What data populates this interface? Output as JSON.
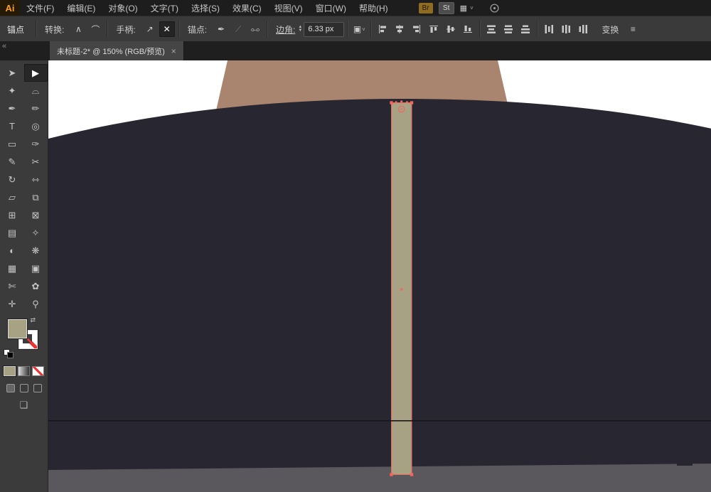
{
  "menubar": {
    "logo_text": "Ai",
    "items": [
      "文件(F)",
      "编辑(E)",
      "对象(O)",
      "文字(T)",
      "选择(S)",
      "效果(C)",
      "视图(V)",
      "窗口(W)",
      "帮助(H)"
    ],
    "br_badge": "Br",
    "st_badge": "St"
  },
  "controlbar": {
    "context_label": "锚点",
    "convert_label": "转换:",
    "handles_label": "手柄:",
    "anchors_label": "锚点:",
    "corner_label": "边角:",
    "corner_value": "6.33 px",
    "transform_label": "变换"
  },
  "tabbar": {
    "title": "未标题-2* @ 150% (RGB/预览)"
  },
  "icons": {
    "close": "×",
    "collapse": "«",
    "convert_corner": "∧",
    "convert_smooth": "⌒",
    "handle_show": "↗",
    "handle_hide": "✕",
    "anchor_pen": "✒",
    "anchor_cut": "⟋",
    "anchor_link": "⧟",
    "spinner_up": "▲",
    "spinner_down": "▼",
    "isolate": "▣",
    "chevron_down": "˅",
    "workspace": "▦",
    "panel_menu": "≡",
    "swap": "⇄",
    "screen_mode": "❏"
  },
  "toolbar": {
    "tools": [
      {
        "name": "selection-tool",
        "glyph": "➤"
      },
      {
        "name": "direct-selection-tool",
        "glyph": "▶"
      },
      {
        "name": "magic-wand-tool",
        "glyph": "✦"
      },
      {
        "name": "lasso-tool",
        "glyph": "⌓"
      },
      {
        "name": "pen-tool",
        "glyph": "✒"
      },
      {
        "name": "curvature-tool",
        "glyph": "✏"
      },
      {
        "name": "type-tool",
        "glyph": "T"
      },
      {
        "name": "line-segment-tool",
        "glyph": "◎"
      },
      {
        "name": "rectangle-tool",
        "glyph": "▭"
      },
      {
        "name": "paintbrush-tool",
        "glyph": "✑"
      },
      {
        "name": "pencil-tool",
        "glyph": "✎"
      },
      {
        "name": "scissors-tool",
        "glyph": "✂"
      },
      {
        "name": "rotate-tool",
        "glyph": "↻"
      },
      {
        "name": "width-tool",
        "glyph": "⇿"
      },
      {
        "name": "free-transform-tool",
        "glyph": "▱"
      },
      {
        "name": "shape-builder-tool",
        "glyph": "⧉"
      },
      {
        "name": "perspective-grid-tool",
        "glyph": "⊞"
      },
      {
        "name": "mesh-tool",
        "glyph": "⊠"
      },
      {
        "name": "gradient-tool",
        "glyph": "▤"
      },
      {
        "name": "eyedropper-tool",
        "glyph": "✧"
      },
      {
        "name": "blend-tool",
        "glyph": "◐"
      },
      {
        "name": "symbol-sprayer-tool",
        "glyph": "❋"
      },
      {
        "name": "column-graph-tool",
        "glyph": "▦"
      },
      {
        "name": "artboard-tool",
        "glyph": "▣"
      },
      {
        "name": "slice-tool",
        "glyph": "✄"
      },
      {
        "name": "shaper-tool",
        "glyph": "✿"
      },
      {
        "name": "hand-tool",
        "glyph": "✛"
      },
      {
        "name": "zoom-tool",
        "glyph": "⚲"
      }
    ]
  },
  "colors": {
    "canvas_bg": "#ffffff",
    "neck": "#a9846e",
    "coat": "#282631",
    "strip": "#5a585c",
    "bar_fill": "#a8a284",
    "selection": "#f4655e",
    "seam": "#17151c",
    "fill_swatch": "#a8a284"
  }
}
